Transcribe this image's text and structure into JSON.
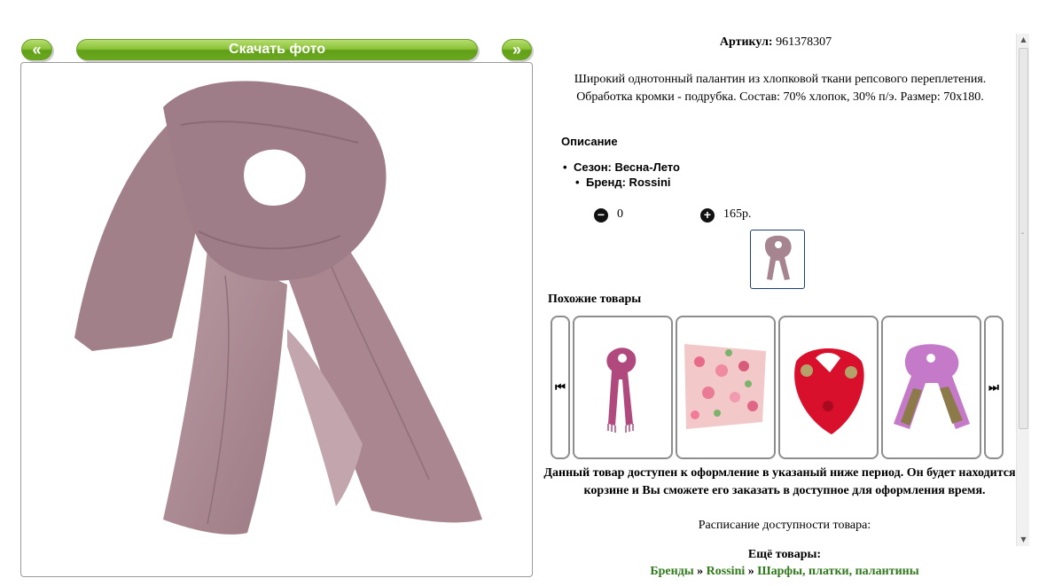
{
  "nav": {
    "prev_label": "«",
    "download_label": "Скачать фото",
    "next_label": "»"
  },
  "product": {
    "article_label": "Артикул:",
    "article_value": "961378307",
    "description": "Широкий однотонный палантин из хлопковой ткани репсового переплетения. Обработка кромки - подрубка. Состав: 70% хлопок, 30% п/э. Размер: 70х180.",
    "description_heading": "Описание",
    "properties": [
      "Сезон: Весна-Лето",
      "Бренд: Rossini"
    ],
    "quantity": "0",
    "price": "165р.",
    "color_main": "#a88590"
  },
  "similar": {
    "heading": "Похожие товары",
    "prev_icon": "skip-back-icon",
    "next_icon": "skip-forward-icon",
    "items": [
      "pink-scarf",
      "floral-scarf",
      "red-scarf",
      "violet-paisley-scarf"
    ]
  },
  "notice": {
    "text": "Данный товар доступен к оформление в указаный ниже период. Он будет находится в корзине и Вы сможете его заказать в доступное для оформления время.",
    "schedule": "Расписание доступности товара:"
  },
  "more": {
    "heading": "Ещё товары:",
    "breadcrumbs": [
      "Бренды",
      "Rossini",
      "Шарфы, платки, палантины"
    ],
    "separator": "»"
  },
  "colors": {
    "accent_green": "#6aa81e",
    "link_green": "#2f7a1a"
  }
}
